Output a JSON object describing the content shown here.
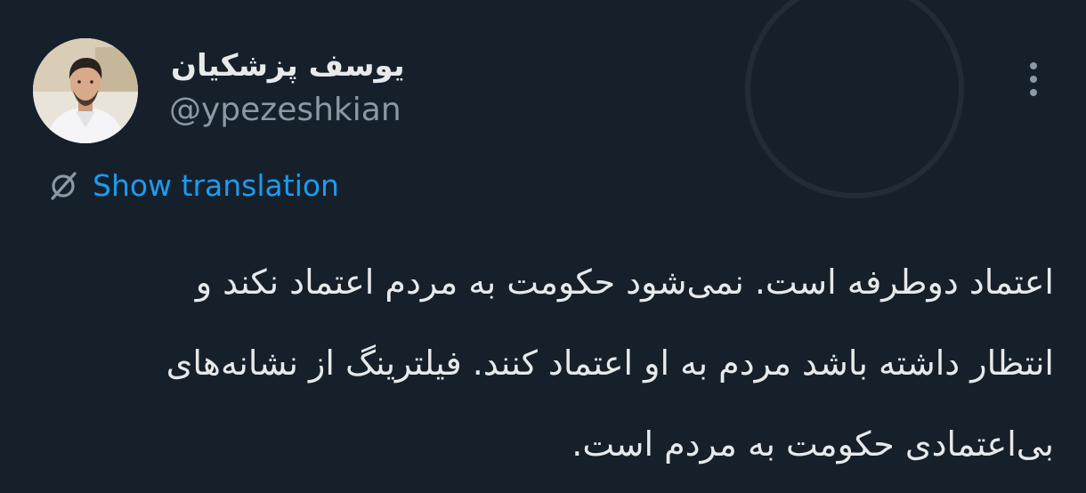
{
  "tweet": {
    "author": {
      "display_name": "یوسف پزشکیان",
      "handle": "@ypezeshkian",
      "avatar_icon": "user-avatar"
    },
    "more_icon": "more-vertical-icon",
    "translation": {
      "icon": "translate-slash-icon",
      "label": "Show translation"
    },
    "text_lines": [
      "اعتماد دوطرفه است. نمی‌شود حکومت به مردم اعتماد نکند و",
      "انتظار داشته باشد مردم به او اعتماد کنند. فیلترینگ از نشانه‌های",
      "بی‌اعتمادی حکومت به مردم است."
    ]
  },
  "colors": {
    "background": "#15202b",
    "primary_text": "#e7e9ea",
    "secondary_text": "#8b98a5",
    "accent": "#1d9bf0"
  }
}
